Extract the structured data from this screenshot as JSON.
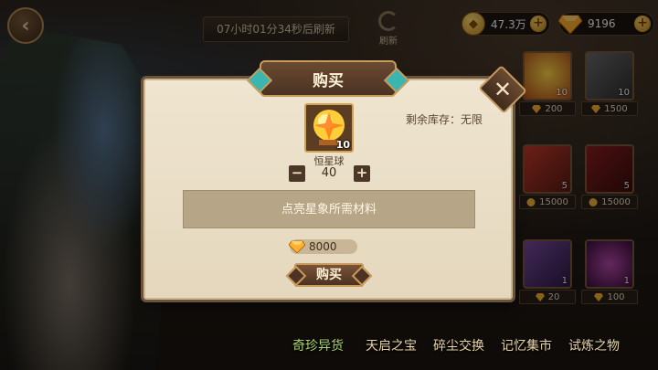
{
  "header": {
    "refresh_timer": "07小时01分34秒后刷新",
    "refresh_label": "刷新",
    "gold_amount": "47.3万",
    "gem_amount": "9196"
  },
  "shop_grid": [
    {
      "count": "10",
      "price": "200"
    },
    {
      "count": "10",
      "price": "1500"
    },
    {
      "count": "5",
      "price": "15000"
    },
    {
      "count": "5",
      "price": "15000"
    },
    {
      "count": "1",
      "price": "20"
    },
    {
      "count": "1",
      "price": "100"
    }
  ],
  "tabs": [
    {
      "label": "奇珍异货",
      "active": true
    },
    {
      "label": "天启之宝",
      "active": false
    },
    {
      "label": "碎尘交换",
      "active": false
    },
    {
      "label": "记忆集市",
      "active": false
    },
    {
      "label": "试炼之物",
      "active": false
    }
  ],
  "modal": {
    "title": "购买",
    "stock_label": "剩余库存：无限",
    "item_name": "恒星球",
    "item_count": "10",
    "quantity": "40",
    "minus": "−",
    "plus": "+",
    "description": "点亮星象所需材料",
    "total_price": "8000",
    "buy_label": "购买",
    "close": "✕"
  },
  "colors": {
    "gold": "#f2b43a",
    "gem": "#ff9a1a",
    "panel": "#eadfc8",
    "accent": "#39b6b0"
  }
}
